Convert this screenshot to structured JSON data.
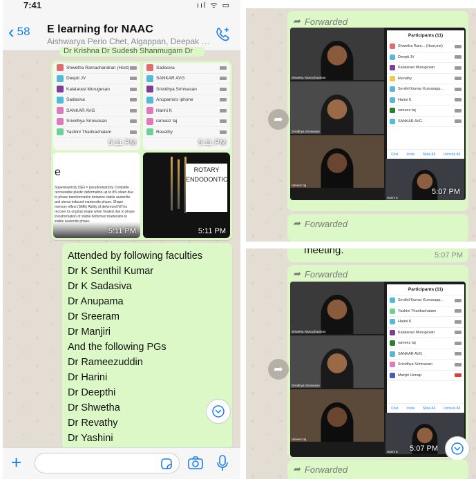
{
  "left": {
    "status_time": "7:41",
    "status_icons": "ııl ᯤ ▭",
    "back_count": "58",
    "chat_title": "E learning for NAAC",
    "chat_subtitle": "Aishwarya Perio Chet, Algappan, Deepak Pr...",
    "peek_text": "Dr Krishna Dr Sudesh Shanmugam Dr",
    "tile1": {
      "time": "5:11 PM",
      "participants": [
        "Shwetha Ramachandran (Host)",
        "Deepti JV",
        "Kalaiarasi Murugesan",
        "Sadasiva",
        "SANKAR AVG",
        "Srividhya Srinivasan",
        "Yashini Tharikachalam"
      ],
      "avatar_letters": [
        "SR",
        "DJ",
        "K",
        "S",
        "SA",
        "SS",
        "YT"
      ]
    },
    "tile2": {
      "time": "5:11 PM",
      "participants": [
        "Sadasiva",
        "SANKAR AVG",
        "Srividhya Srinivasan",
        "Anupama's iphone",
        "Harini K",
        "rameez taj",
        "Revathy"
      ],
      "avatar_letters": [
        "S",
        "SA",
        "SS",
        "AI",
        "HK",
        "R",
        "R"
      ]
    },
    "tile3": {
      "time": "5:11 PM",
      "heading": "e",
      "body": "Superelasticity (SE) = pseudoelasticity   Complete recoverable plastic deformation up to 8% strain due to phase transformation between stable austenite and stress-induced martensite phase. Shape memory effect (SME)   Ability of deformed NiTi to recover its original shape when heated due to phase transformation of stable deformed martensite to stable austenite phase."
    },
    "tile4": {
      "time": "5:11 PM",
      "rotary_text": "ROTARY ENDODONTIC"
    },
    "message_lines": [
      "Attended by following faculties",
      "Dr K Senthil Kumar",
      "Dr K Sadasiva",
      "Dr Anupama",
      "Dr Sreeram",
      "Dr Manjiri",
      "And the following PGs",
      "Dr Rameezuddin",
      "Dr Harini",
      "Dr Deepthi",
      "Dr Shwetha",
      "Dr Revathy",
      "Dr Yashini"
    ]
  },
  "right_top": {
    "forwarded_label": "Forwarded",
    "time": "5:07 PM",
    "forwarded_label_2": "Forwarded",
    "participants_header": "Participants (11)",
    "participants": [
      "Shwetha Ram... (Host,me)",
      "Deepti JV",
      "Kalaiarasi Murugesan",
      "Revathy",
      "Senthil Kumar Kumarapp...",
      "Harini K",
      "rameez taj",
      "SANKAR AVG"
    ],
    "avatar_letters": [
      "SR",
      "DJ",
      "K",
      "R",
      "SK",
      "HK",
      "R",
      "SA"
    ],
    "avatar_colors": [
      "#e26c6c",
      "#55b9d8",
      "#7c3f96",
      "#f2c94c",
      "#55b9d8",
      "#55b9d8",
      "#2e7d32",
      "#55b9d8"
    ],
    "footer": [
      "Chat",
      "Invite",
      "Mute All",
      "Unmute All"
    ],
    "video_labels": [
      "Shwetha Ramachandran",
      "Srividhya Srinivasan",
      "rameez taj",
      "Harini K"
    ]
  },
  "right_bottom": {
    "peek_text": "meeting.",
    "peek_time": "5:07 PM",
    "forwarded_label": "Forwarded",
    "time": "5:07 PM",
    "forwarded_label_2": "Forwarded",
    "participants_header": "Participants (11)",
    "participants": [
      "Senthil Kumar Kumarapp...",
      "Yashini Tharikachalam",
      "Harini K",
      "Kalaiarasi Murugesan",
      "rameez taj",
      "SANKAR AVG",
      "Srividhya Srinivasan",
      "Manjiri Honap"
    ],
    "avatar_letters": [
      "SK",
      "YT",
      "HK",
      "K",
      "R",
      "SA",
      "SS",
      "MH"
    ],
    "avatar_colors": [
      "#55b9d8",
      "#6fcf97",
      "#55b9d8",
      "#7c3f96",
      "#2e7d32",
      "#55b9d8",
      "#e07ab8",
      "#4a5bb5"
    ],
    "footer": [
      "Chat",
      "Invite",
      "Mute All",
      "Unmute All"
    ],
    "video_labels": [
      "Shwetha Ramachandran",
      "Srividhya Srinivasan",
      "rameez taj",
      "Harini K"
    ]
  },
  "colors": {
    "accent": "#1a7cf4",
    "bubble": "#dcf8c6",
    "wallpaper": "#e4ddd4",
    "zoom_blue": "#2d8cff"
  }
}
